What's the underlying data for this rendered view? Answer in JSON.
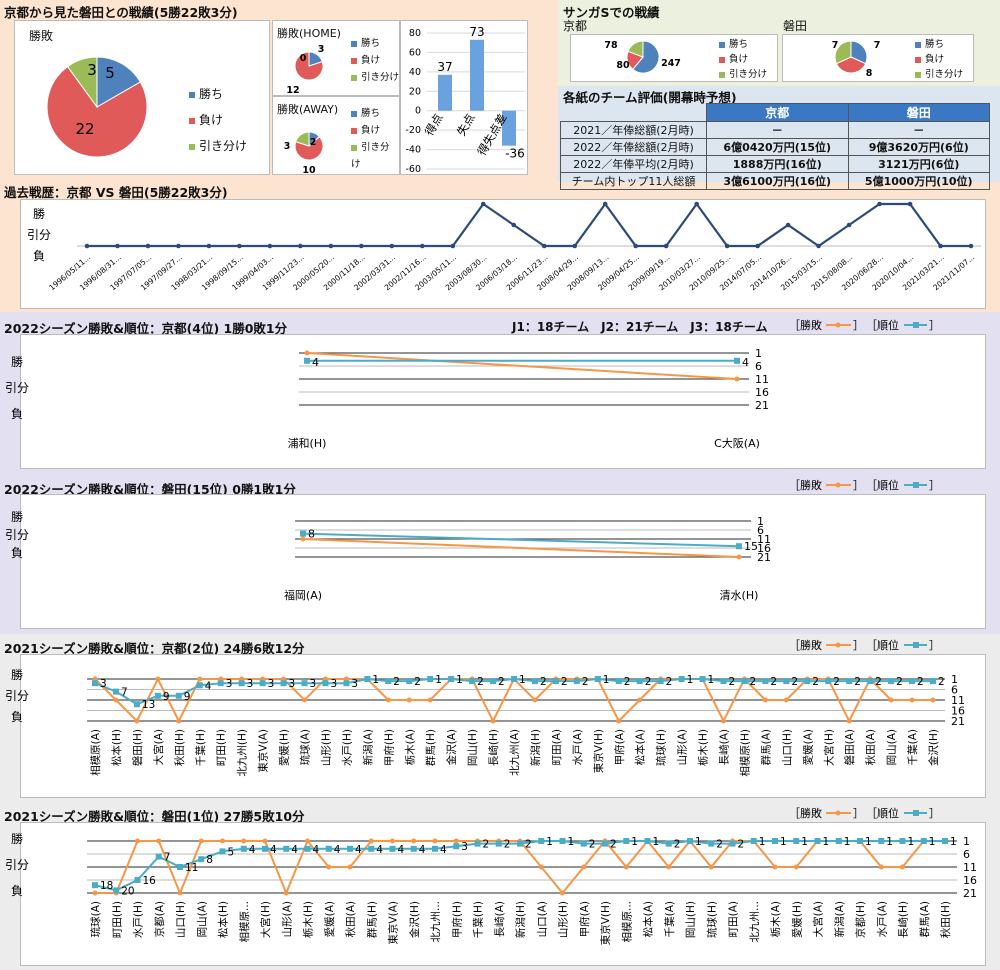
{
  "colors": {
    "win": "#4f81bd",
    "loss": "#e05a5a",
    "draw": "#9bbb59",
    "line_result": "#f79646",
    "line_rank": "#4bacc6",
    "hist_line": "#2e4a78",
    "bar": "#6aa2e0"
  },
  "h2h": {
    "title": "京都から見た磐田との戦績(5勝22敗3分)",
    "overall": {
      "label": "勝敗",
      "win": 5,
      "loss": 22,
      "draw": 3
    },
    "home": {
      "label": "勝敗(HOME)",
      "win": 3,
      "loss": 12,
      "draw": 0
    },
    "away": {
      "label": "勝敗(AWAY)",
      "win": 2,
      "loss": 10,
      "draw": 3
    },
    "legend": {
      "win": "勝ち",
      "loss": "負け",
      "draw": "引き分け"
    },
    "goals": {
      "labels": [
        "得点",
        "失点",
        "得失点差"
      ],
      "values": [
        37,
        73,
        -36
      ],
      "ticks": [
        "80",
        "60",
        "40",
        "20",
        "0",
        "-20",
        "-40",
        "-60"
      ]
    }
  },
  "sanga": {
    "title": "サンガSでの戦績",
    "kyoto": {
      "name": "京都",
      "win": 247,
      "loss": 80,
      "draw": 78
    },
    "iwata": {
      "name": "磐田",
      "win": 7,
      "loss": 8,
      "draw": 7
    }
  },
  "eval": {
    "title": "各紙のチーム評価(開幕時予想)",
    "headers": [
      "京都",
      "磐田"
    ],
    "rows": [
      {
        "label": "2021／年俸総額(2月時)",
        "kyoto": "－",
        "iwata": "－"
      },
      {
        "label": "2022／年俸総額(2月時)",
        "kyoto": "6億0420万円(15位)",
        "iwata": "9億3620万円(6位)"
      },
      {
        "label": "2022／年俸平均(2月時)",
        "kyoto": "1888万円(16位)",
        "iwata": "3121万円(6位)"
      },
      {
        "label": "チーム内トップ11人総額",
        "kyoto": "3億6100万円(16位)",
        "iwata": "5億1000万円(10位)"
      }
    ]
  },
  "history": {
    "title": "過去戦歴：京都 VS 磐田(5勝22敗3分)",
    "ylabels": [
      "勝",
      "引分",
      "負"
    ],
    "dates": [
      "1996/05/11...",
      "1996/08/31...",
      "1997/07/05...",
      "1997/09/27...",
      "1998/03/21...",
      "1998/09/15...",
      "1999/04/03...",
      "1999/11/23...",
      "2000/05/20...",
      "2000/11/18...",
      "2002/03/31...",
      "2002/11/16...",
      "2003/05/11...",
      "2003/08/30...",
      "2006/03/18...",
      "2006/11/23...",
      "2008/04/29...",
      "2008/09/13...",
      "2009/04/25...",
      "2009/09/19...",
      "2010/03/27...",
      "2010/09/25...",
      "2014/07/05...",
      "2014/10/26...",
      "2015/03/15...",
      "2015/08/08...",
      "2020/06/28...",
      "2020/10/04...",
      "2021/03/21...",
      "2021/11/07..."
    ],
    "results": [
      "L",
      "L",
      "L",
      "L",
      "L",
      "L",
      "L",
      "L",
      "L",
      "L",
      "L",
      "L",
      "L",
      "W",
      "D",
      "L",
      "L",
      "W",
      "L",
      "L",
      "W",
      "L",
      "L",
      "D",
      "L",
      "D",
      "W",
      "W",
      "L",
      "L"
    ]
  },
  "legend_labels": {
    "result": "勝敗",
    "rank": "順位"
  },
  "season_chart_yl": [
    "勝",
    "引分",
    "負"
  ],
  "rank_ticks": [
    "1",
    "6",
    "11",
    "16",
    "21"
  ],
  "j_note": "J1：18チーム　J2：21チーム　J3：18チーム",
  "chart_data": [
    {
      "type": "line",
      "title": "2022シーズン勝敗&順位：京都(4位) 1勝0敗1分",
      "x": [
        "浦和(H)",
        "C大阪(A)"
      ],
      "series": [
        {
          "name": "勝敗",
          "values": [
            "W",
            "D"
          ]
        },
        {
          "name": "順位",
          "values": [
            4,
            4
          ]
        }
      ]
    },
    {
      "type": "line",
      "title": "2022シーズン勝敗&順位：磐田(15位) 0勝1敗1分",
      "x": [
        "福岡(A)",
        "清水(H)"
      ],
      "series": [
        {
          "name": "勝敗",
          "values": [
            "D",
            "L"
          ]
        },
        {
          "name": "順位",
          "values": [
            8,
            15
          ]
        }
      ]
    },
    {
      "type": "line",
      "title": "2021シーズン勝敗&順位：京都(2位) 24勝6敗12分",
      "x": [
        "相模原(A)",
        "松本(H)",
        "磐田(H)",
        "大宮(A)",
        "秋田(H)",
        "千葉(H)",
        "町田(H)",
        "北九州(H)",
        "東京V(A)",
        "愛媛(H)",
        "琉球(A)",
        "山形(H)",
        "水戸(H)",
        "新潟(A)",
        "甲府(H)",
        "栃木(A)",
        "群馬(H)",
        "金沢(A)",
        "岡山(H)",
        "長崎(H)",
        "北九州(A)",
        "新潟(H)",
        "町田(A)",
        "水戸(A)",
        "東京V(H)",
        "甲府(A)",
        "松本(A)",
        "琉球(H)",
        "山形(A)",
        "栃木(H)",
        "長崎(A)",
        "相模原(H)",
        "群馬(A)",
        "山口(H)",
        "愛媛(A)",
        "大宮(H)",
        "磐田(A)",
        "秋田(A)",
        "岡山(A)",
        "千葉(A)",
        "金沢(H)"
      ],
      "series": [
        {
          "name": "勝敗",
          "values": [
            "W",
            "D",
            "L",
            "W",
            "L",
            "W",
            "W",
            "W",
            "W",
            "W",
            "D",
            "W",
            "W",
            "W",
            "D",
            "D",
            "D",
            "W",
            "W",
            "L",
            "W",
            "D",
            "W",
            "W",
            "W",
            "L",
            "D",
            "W",
            "W",
            "W",
            "L",
            "W",
            "D",
            "D",
            "W",
            "W",
            "L",
            "W",
            "D",
            "D",
            "D"
          ]
        },
        {
          "name": "順位",
          "values": [
            3,
            7,
            13,
            9,
            9,
            4,
            3,
            3,
            3,
            3,
            3,
            3,
            3,
            1,
            2,
            2,
            1,
            1,
            2,
            2,
            1,
            2,
            2,
            2,
            1,
            2,
            2,
            2,
            1,
            1,
            2,
            2,
            2,
            2,
            2,
            2,
            2,
            2,
            2,
            2,
            2
          ]
        }
      ]
    },
    {
      "type": "line",
      "title": "2021シーズン勝敗&順位：磐田(1位) 27勝5敗10分",
      "x": [
        "琉球(A)",
        "町田(H)",
        "水戸(H)",
        "京都(A)",
        "山口(H)",
        "岡山(A)",
        "松本(H)",
        "相模原...",
        "大宮(H)",
        "山形(A)",
        "栃木(H)",
        "愛媛(A)",
        "秋田(A)",
        "群馬(H)",
        "東京V(A)",
        "金沢(H)",
        "北九州...",
        "甲府(H)",
        "千葉(H)",
        "長崎(A)",
        "新潟(H)",
        "山口(A)",
        "山形(H)",
        "甲府(A)",
        "東京V(H)",
        "相模原...",
        "松本(A)",
        "千葉(A)",
        "岡山(H)",
        "琉球(H)",
        "町田(A)",
        "北九州...",
        "栃木(A)",
        "愛媛(H)",
        "大宮(A)",
        "新潟(A)",
        "京都(H)",
        "水戸(A)",
        "長崎(H)",
        "群馬(A)",
        "秋田(H)"
      ],
      "series": [
        {
          "name": "勝敗",
          "values": [
            "L",
            "L",
            "W",
            "W",
            "L",
            "W",
            "W",
            "W",
            "W",
            "L",
            "W",
            "D",
            "D",
            "W",
            "W",
            "W",
            "W",
            "W",
            "W",
            "W",
            "W",
            "D",
            "L",
            "D",
            "W",
            "D",
            "W",
            "D",
            "W",
            "D",
            "W",
            "W",
            "D",
            "D",
            "W",
            "W",
            "W",
            "D",
            "D",
            "W",
            "W"
          ]
        },
        {
          "name": "順位",
          "values": [
            18,
            20,
            16,
            7,
            11,
            8,
            5,
            4,
            4,
            4,
            4,
            4,
            4,
            4,
            4,
            4,
            4,
            3,
            2,
            2,
            2,
            1,
            1,
            2,
            2,
            1,
            1,
            2,
            1,
            2,
            2,
            1,
            1,
            1,
            1,
            1,
            1,
            1,
            1,
            1,
            1
          ]
        }
      ]
    }
  ]
}
